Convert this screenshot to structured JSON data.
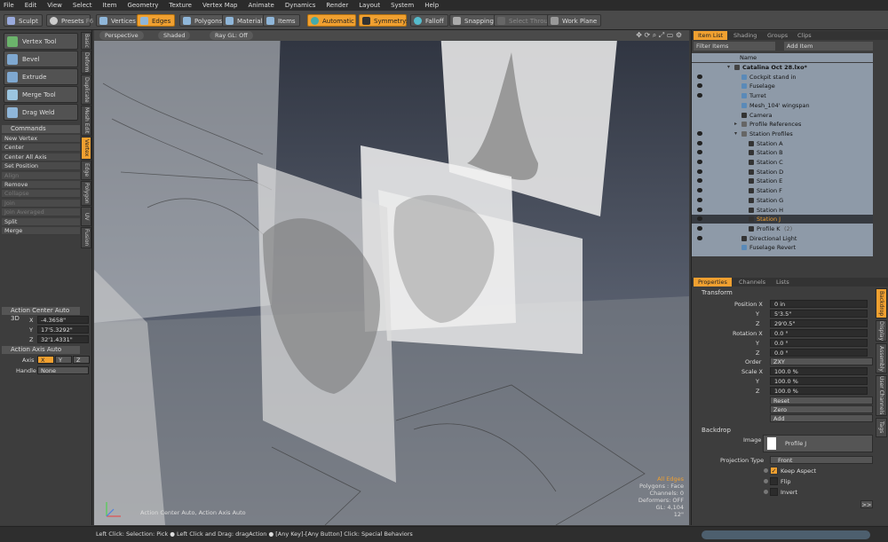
{
  "menu": [
    "File",
    "Edit",
    "View",
    "Select",
    "Item",
    "Geometry",
    "Texture",
    "Vertex Map",
    "Animate",
    "Dynamics",
    "Render",
    "Layout",
    "System",
    "Help"
  ],
  "toolbar": {
    "sculpt": "Sculpt",
    "presets": "Presets",
    "presets_key": "F6",
    "vertices": "Vertices",
    "edges": "Edges",
    "polygons": "Polygons",
    "materials": "Materials",
    "items": "Items",
    "automatic": "Automatic",
    "symmetry": "Symmetry: X",
    "falloff": "Falloff",
    "snapping": "Snapping",
    "select_through": "Select Through",
    "work_plane": "Work Plane"
  },
  "left": {
    "tools": [
      "Vertex Tool",
      "Bevel",
      "Extrude",
      "Merge Tool",
      "Drag Weld"
    ],
    "vtabs": [
      "Basic",
      "Deform",
      "Duplicate",
      "Mesh Edit",
      "Vertex",
      "Edge",
      "Polygon",
      "UV",
      "Fusion"
    ],
    "vtab_active": "Vertex",
    "commands_title": "Commands",
    "commands": [
      {
        "label": "New Vertex",
        "enabled": true
      },
      {
        "label": "Center",
        "enabled": true
      },
      {
        "label": "Center All Axis",
        "enabled": true
      },
      {
        "label": "Set Position",
        "enabled": true
      },
      {
        "label": "Align",
        "enabled": false
      },
      {
        "label": "Remove",
        "enabled": true
      },
      {
        "label": "Collapse",
        "enabled": false
      },
      {
        "label": "Join",
        "enabled": false
      },
      {
        "label": "Join Averaged",
        "enabled": false
      },
      {
        "label": "Split",
        "enabled": true
      },
      {
        "label": "Merge",
        "enabled": true
      }
    ],
    "action_center_title": "Action Center Auto 3D",
    "x_label": "X",
    "x_value": "-4.3658\"",
    "y_label": "Y",
    "y_value": "17'5.3292\"",
    "z_label": "Z",
    "z_value": "32'1.4331\"",
    "action_axis_title": "Action Axis Auto",
    "axis_label": "Axis",
    "axis_options": [
      "X",
      "Y",
      "Z"
    ],
    "axis_selected": "X",
    "handle_label": "Handle",
    "handle_value": "None"
  },
  "viewport": {
    "perspective": "Perspective",
    "shaded": "Shaded",
    "raygl": "Ray GL: Off",
    "info_mode": "All Edges",
    "info_polygons": "Polygons : Face",
    "info_channels": "Channels: 0",
    "info_deformers": "Deformers: OFF",
    "info_gl": "GL: 4,104",
    "info_size": "12\"",
    "bottom_label": "Action Center Auto, Action Axis Auto"
  },
  "itemlist": {
    "tabs": [
      "Item List",
      "Shading",
      "Groups",
      "Clips"
    ],
    "active_tab": "Item List",
    "filter": "Filter Items",
    "add_item": "Add Item",
    "col_name": "Name",
    "rows": [
      {
        "name": "Catalina Oct 28.lxo*",
        "indent": 0,
        "type": "scene",
        "eye": false,
        "bold": true,
        "selected": false
      },
      {
        "name": "Cockpit stand in",
        "indent": 1,
        "type": "mesh",
        "eye": true,
        "bold": false,
        "selected": false
      },
      {
        "name": "Fuselage",
        "indent": 1,
        "type": "mesh",
        "eye": true,
        "bold": false,
        "selected": false
      },
      {
        "name": "Turret",
        "indent": 1,
        "type": "mesh",
        "eye": true,
        "bold": false,
        "selected": false
      },
      {
        "name": "Mesh_104' wingspan",
        "indent": 1,
        "type": "mesh",
        "eye": false,
        "bold": false,
        "selected": false
      },
      {
        "name": "Camera",
        "indent": 1,
        "type": "camera",
        "eye": false,
        "bold": false,
        "selected": false
      },
      {
        "name": "Profile References",
        "indent": 1,
        "type": "group",
        "eye": false,
        "bold": false,
        "selected": false
      },
      {
        "name": "Station Profiles",
        "indent": 1,
        "type": "group",
        "eye": true,
        "bold": false,
        "selected": false
      },
      {
        "name": "Station A",
        "indent": 2,
        "type": "image",
        "eye": true,
        "bold": false,
        "selected": false
      },
      {
        "name": "Station B",
        "indent": 2,
        "type": "image",
        "eye": true,
        "bold": false,
        "selected": false
      },
      {
        "name": "Station C",
        "indent": 2,
        "type": "image",
        "eye": true,
        "bold": false,
        "selected": false
      },
      {
        "name": "Station D",
        "indent": 2,
        "type": "image",
        "eye": true,
        "bold": false,
        "selected": false
      },
      {
        "name": "Station E",
        "indent": 2,
        "type": "image",
        "eye": true,
        "bold": false,
        "selected": false
      },
      {
        "name": "Station F",
        "indent": 2,
        "type": "image",
        "eye": true,
        "bold": false,
        "selected": false
      },
      {
        "name": "Station G",
        "indent": 2,
        "type": "image",
        "eye": true,
        "bold": false,
        "selected": false
      },
      {
        "name": "Station H",
        "indent": 2,
        "type": "image",
        "eye": true,
        "bold": false,
        "selected": false
      },
      {
        "name": "Station J",
        "indent": 2,
        "type": "image",
        "eye": true,
        "bold": false,
        "selected": true
      },
      {
        "name": "Profile K",
        "indent": 2,
        "type": "image",
        "eye": true,
        "bold": false,
        "selected": false,
        "suffix": "(2)"
      },
      {
        "name": "Directional Light",
        "indent": 1,
        "type": "light",
        "eye": true,
        "bold": false,
        "selected": false
      },
      {
        "name": "Fuselage Revert",
        "indent": 1,
        "type": "mesh",
        "eye": false,
        "bold": false,
        "selected": false
      }
    ]
  },
  "properties": {
    "tabs": [
      "Properties",
      "Channels",
      "Lists"
    ],
    "active_tab": "Properties",
    "side_tabs": [
      "Backdrop",
      "Display",
      "Assembly",
      "User Channels",
      "Tags"
    ],
    "side_active": "Backdrop",
    "transform_title": "Transform",
    "position_label": "Position X",
    "position": [
      "0 in",
      "5'3.5\"",
      "29'0.5\""
    ],
    "rotation_label": "Rotation X",
    "rotation": [
      "0.0 °",
      "0.0 °",
      "0.0 °"
    ],
    "order_label": "Order",
    "order_value": "ZXY",
    "scale_label": "Scale X",
    "scale": [
      "100.0 %",
      "100.0 %",
      "100.0 %"
    ],
    "y_label": "Y",
    "z_label": "Z",
    "reset": "Reset",
    "zero": "Zero",
    "add": "Add",
    "backdrop_title": "Backdrop",
    "image_label": "Image",
    "image_value": "Profile J",
    "projection_label": "Projection Type",
    "projection_value": "Front",
    "keep_aspect": "Keep Aspect",
    "keep_aspect_checked": true,
    "flip": "Flip",
    "invert": "Invert",
    "more": ">>"
  },
  "status": {
    "text": "Left Click: Selection: Pick ● Left Click and Drag: dragAction ● [Any Key]-[Any Button] Click: Special Behaviors"
  },
  "colors": {
    "accent": "#f0a030",
    "selected_row": "#363a40",
    "list_bg": "#8e9aa8"
  }
}
